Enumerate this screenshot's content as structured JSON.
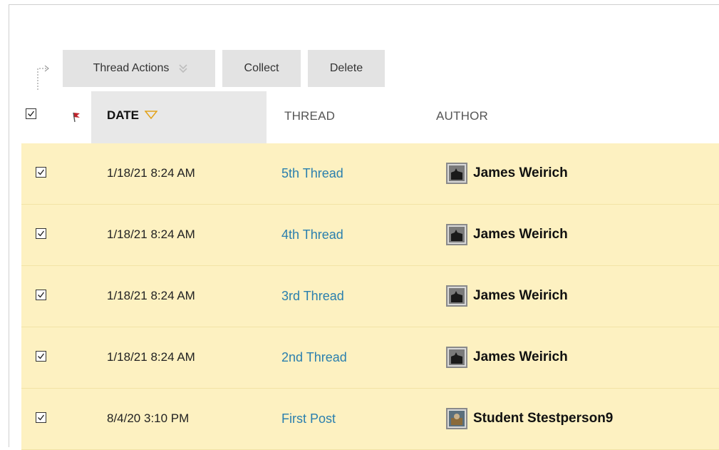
{
  "toolbar": {
    "thread_actions_label": "Thread Actions",
    "collect_label": "Collect",
    "delete_label": "Delete"
  },
  "table": {
    "columns": {
      "date": "DATE",
      "thread": "THREAD",
      "author": "AUTHOR"
    },
    "rows": [
      {
        "date": "1/18/21 8:24 AM",
        "thread": "5th Thread",
        "author": "James Weirich",
        "checked": true
      },
      {
        "date": "1/18/21 8:24 AM",
        "thread": "4th Thread",
        "author": "James Weirich",
        "checked": true
      },
      {
        "date": "1/18/21 8:24 AM",
        "thread": "3rd Thread",
        "author": "James Weirich",
        "checked": true
      },
      {
        "date": "1/18/21 8:24 AM",
        "thread": "2nd Thread",
        "author": "James Weirich",
        "checked": true
      },
      {
        "date": "8/4/20 3:10 PM",
        "thread": "First Post",
        "author": "Student Stestperson9",
        "checked": true
      }
    ]
  },
  "icons": {
    "sort": "sort-descending-icon",
    "flag": "flag-icon",
    "chevron": "double-chevron-down-icon"
  },
  "colors": {
    "row_highlight": "#fdf1c1",
    "link": "#2a7fae",
    "toolbar_button": "#e3e3e3",
    "sorted_header": "#e8e8e8"
  }
}
